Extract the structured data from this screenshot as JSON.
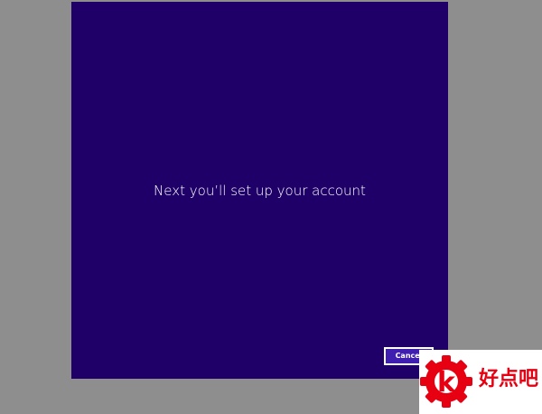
{
  "setup": {
    "message": "Next you’ll set up your account",
    "cancel_label": "Cancel"
  },
  "watermark": {
    "text": "好点吧",
    "logo_letter": "k",
    "color": "#e60012"
  },
  "colors": {
    "background": "#8e8e8e",
    "panel": "#1f0068",
    "cancel_button": "#3f1fb0",
    "text": "#ffffff"
  }
}
